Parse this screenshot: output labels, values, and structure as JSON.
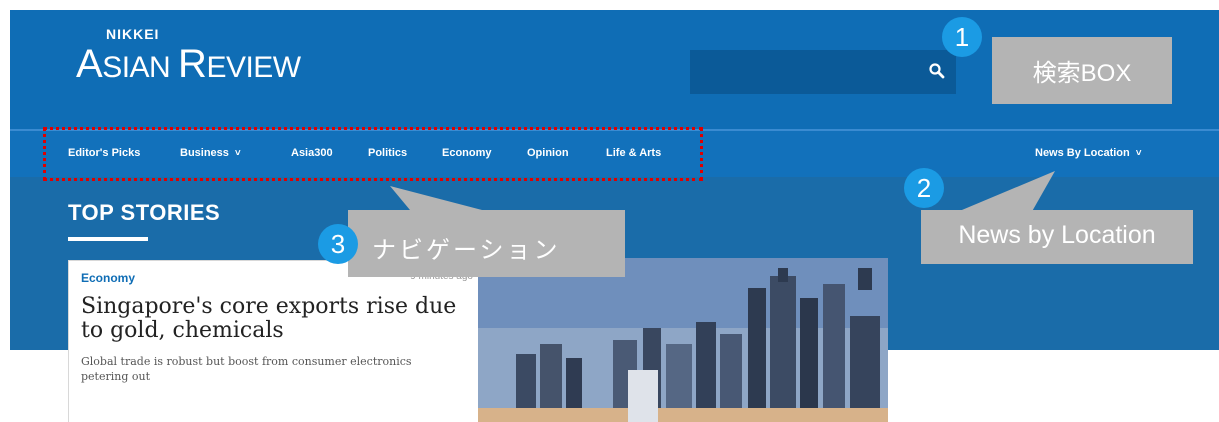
{
  "header": {
    "logo_top": "NIKKEI",
    "logo_main_a": "A",
    "logo_main_b": "SIAN ",
    "logo_main_c": "R",
    "logo_main_d": "EVIEW",
    "search_icon": "search-icon",
    "colors": {
      "header_bg": "#0f6db5",
      "nav_bg": "#1271bb"
    }
  },
  "nav": {
    "items": [
      {
        "label": "Editor's Picks"
      },
      {
        "label": "Business",
        "has_dropdown": true
      },
      {
        "label": "Asia300"
      },
      {
        "label": "Politics"
      },
      {
        "label": "Economy"
      },
      {
        "label": "Opinion"
      },
      {
        "label": "Life & Arts"
      }
    ],
    "location_label": "News By Location",
    "chevron": "˅"
  },
  "main": {
    "section_title": "TOP STORIES",
    "card": {
      "category": "Economy",
      "time": "9 minutes ago",
      "headline": "Singapore's core exports rise due to gold, chemicals",
      "summary": "Global trade is robust but boost from consumer electronics petering out"
    }
  },
  "annotations": {
    "one": {
      "number": "1",
      "label": "検索BOX"
    },
    "two": {
      "number": "2",
      "label": "News by Location"
    },
    "three": {
      "number": "3",
      "label": "ナビゲーション"
    },
    "accent_red": "#e00000",
    "badge_blue": "#1b9be4"
  }
}
